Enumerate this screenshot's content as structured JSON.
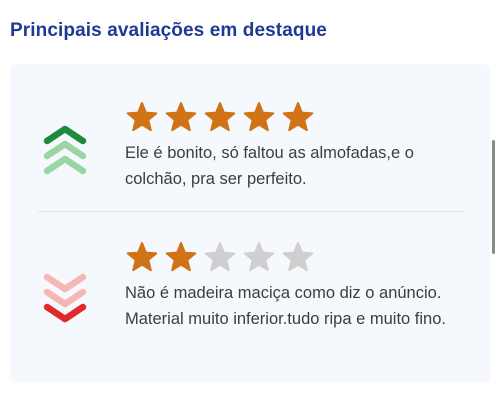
{
  "section": {
    "title": "Principais avaliações em destaque"
  },
  "colors": {
    "title": "#1f3a93",
    "star_filled": "#d07316",
    "star_empty": "#cfcfcf",
    "positive_dark": "#1e8a3c",
    "positive_light": "#9ad6a5",
    "negative_dark": "#e02a2a",
    "negative_light": "#f5b7b4",
    "card_background": "#f5f8fd"
  },
  "reviews": [
    {
      "sentiment": "positive",
      "sentiment_icon": "chevrons-up-icon",
      "rating": 5,
      "max_rating": 5,
      "text": "Ele é bonito, só faltou as almofadas,e o colchão, pra ser perfeito."
    },
    {
      "sentiment": "negative",
      "sentiment_icon": "chevrons-down-icon",
      "rating": 2,
      "max_rating": 5,
      "text": "Não é madeira maciça como diz o anúncio. Material muito inferior.tudo ripa e muito fino."
    }
  ]
}
